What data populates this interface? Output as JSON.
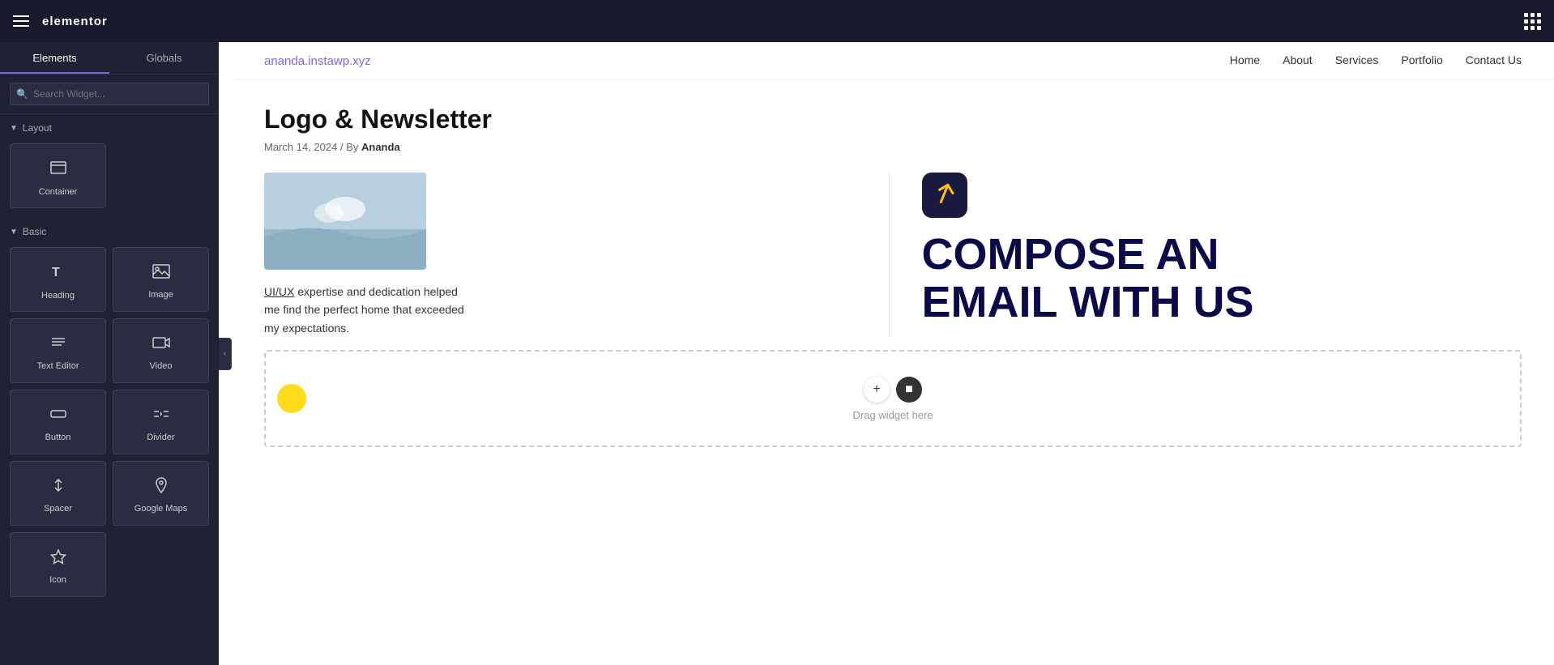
{
  "topbar": {
    "logo": "elementor",
    "hamburger_label": "hamburger-menu",
    "grid_label": "apps-grid"
  },
  "sidebar": {
    "tabs": [
      {
        "id": "elements",
        "label": "Elements",
        "active": true
      },
      {
        "id": "globals",
        "label": "Globals",
        "active": false
      }
    ],
    "search_placeholder": "Search Widget...",
    "sections": {
      "layout": {
        "label": "Layout",
        "widgets": [
          {
            "id": "container",
            "label": "Container",
            "icon": "⬜"
          }
        ]
      },
      "basic": {
        "label": "Basic",
        "widgets": [
          {
            "id": "heading",
            "label": "Heading",
            "icon": "T"
          },
          {
            "id": "image",
            "label": "Image",
            "icon": "🖼"
          },
          {
            "id": "text-editor",
            "label": "Text Editor",
            "icon": "≡"
          },
          {
            "id": "video",
            "label": "Video",
            "icon": "▷"
          },
          {
            "id": "button",
            "label": "Button",
            "icon": "⬜"
          },
          {
            "id": "divider",
            "label": "Divider",
            "icon": "÷"
          },
          {
            "id": "spacer",
            "label": "Spacer",
            "icon": "↕"
          },
          {
            "id": "google-maps",
            "label": "Google Maps",
            "icon": "📍"
          },
          {
            "id": "icon",
            "label": "Icon",
            "icon": "★"
          }
        ]
      }
    }
  },
  "site": {
    "url": "ananda.instawp.xyz",
    "nav": [
      {
        "label": "Home"
      },
      {
        "label": "About"
      },
      {
        "label": "Services"
      },
      {
        "label": "Portfolio"
      },
      {
        "label": "Contact Us"
      }
    ]
  },
  "post": {
    "title": "Logo & Newsletter",
    "date": "March 14, 2024",
    "by": "By",
    "author": "Ananda"
  },
  "content": {
    "testimonial": "UI/UX expertise and dedication helped me find the perfect home that exceeded my expectations.",
    "compose_line1": "COMPOSE AN",
    "compose_line2": "EMAIL WITH US"
  },
  "dropzone": {
    "label": "Drag widget here",
    "add_btn": "+",
    "widget_btn": "⬛"
  }
}
